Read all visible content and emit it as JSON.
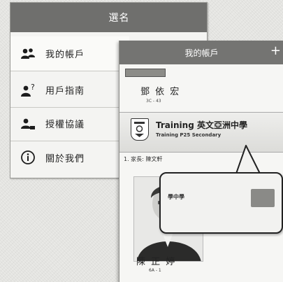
{
  "menu": {
    "title": "選名",
    "items": [
      {
        "label": "我的帳戶",
        "icon": "users-icon"
      },
      {
        "label": "用戶指南",
        "icon": "user-help-icon"
      },
      {
        "label": "授權協議",
        "icon": "user-agreement-icon"
      },
      {
        "label": "關於我們",
        "icon": "info-icon"
      }
    ]
  },
  "account": {
    "title": "我的帳戶",
    "add_symbol": "+",
    "students": [
      {
        "name": "鄧 依 宏",
        "class": "3C - 43"
      },
      {
        "name": "陳 正 婷",
        "class": "6A - 1"
      }
    ],
    "school": {
      "name": "Training 英文亞洲中學",
      "subtitle": "Training P25 Secondary"
    },
    "parent_line": "1. 家長: 陳文軒"
  },
  "callout": {
    "school_label": "學中學"
  }
}
